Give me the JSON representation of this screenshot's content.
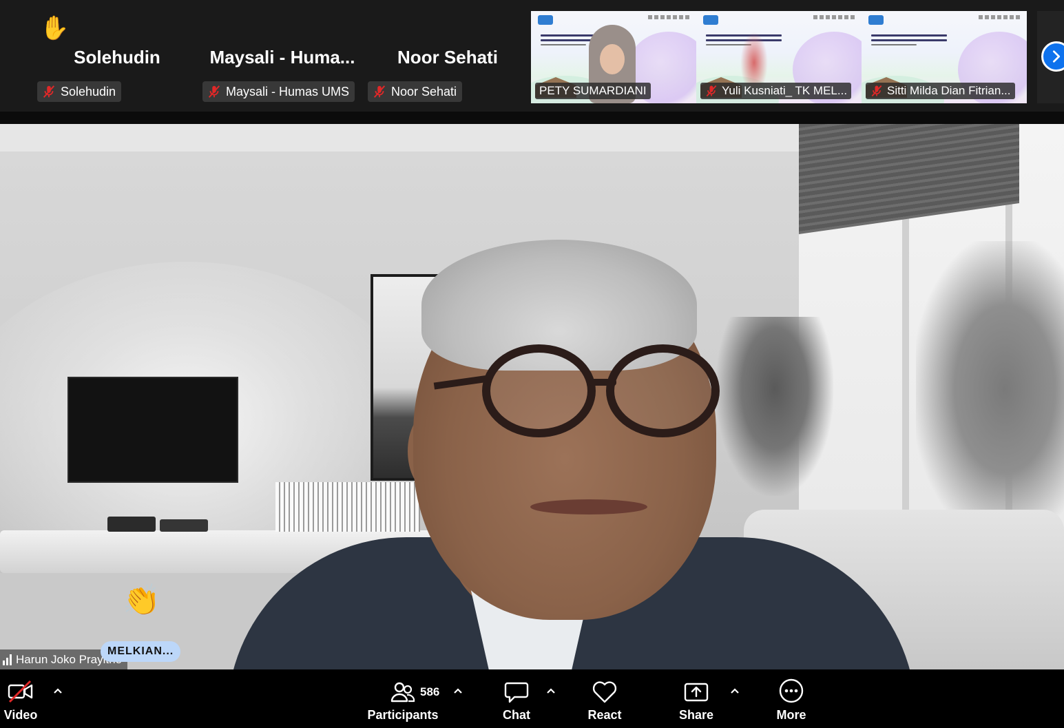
{
  "top_strip": {
    "tiles": [
      {
        "big_name": "Solehudin",
        "chip_name": "Solehudin",
        "raised_hand": true
      },
      {
        "big_name": "Maysali  - Huma...",
        "chip_name": "Maysali - Humas UMS",
        "raised_hand": false
      },
      {
        "big_name": "Noor Sehati",
        "chip_name": "Noor Sehati",
        "raised_hand": false
      }
    ],
    "video_thumbs": [
      {
        "name": "PETY SUMARDIANI",
        "muted": false,
        "has_face": true
      },
      {
        "name": "Yuli Kusniati_ TK MEL...",
        "muted": true,
        "has_face": false
      },
      {
        "name": "Sitti Milda Dian Fitrian...",
        "muted": true,
        "has_face": false
      }
    ],
    "hand_emoji": "✋",
    "next_button_icon": "chevron-right-icon"
  },
  "main_video": {
    "speaker_name": "Harun Joko Prayitno",
    "reaction_emoji": "👏",
    "reaction_user": "MELKIAN..."
  },
  "toolbar": {
    "video_label": "Video",
    "participants_label": "Participants",
    "participants_count": "586",
    "chat_label": "Chat",
    "react_label": "React",
    "share_label": "Share",
    "more_label": "More"
  },
  "colors": {
    "accent_blue": "#0e72ed",
    "muted_red": "#e02828",
    "reaction_tag_bg": "#bcd7f9",
    "toolbar_bg": "#000000",
    "strip_bg": "#1a1a1a"
  }
}
